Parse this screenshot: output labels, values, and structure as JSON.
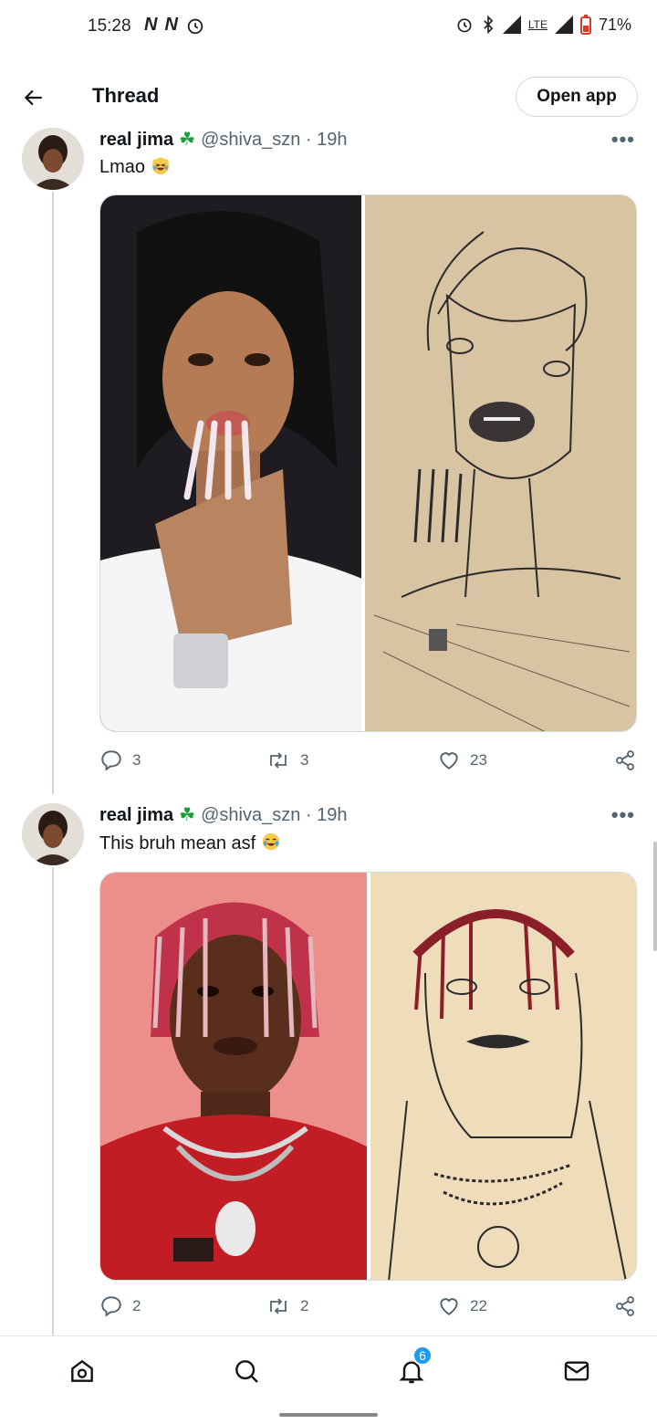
{
  "status_bar": {
    "time": "15:28",
    "network": "LTE",
    "battery": "71%"
  },
  "header": {
    "title": "Thread",
    "open_app_label": "Open app"
  },
  "tweets": [
    {
      "name": "real jima",
      "handle": "@shiva_szn",
      "time": "19h",
      "text": "Lmao",
      "emoji": "laughing-cat-emoji",
      "replies": "3",
      "retweets": "3",
      "likes": "23",
      "media": [
        "photo-cardi-b",
        "drawing-cardi-b"
      ]
    },
    {
      "name": "real jima",
      "handle": "@shiva_szn",
      "time": "19h",
      "text": "This bruh mean asf",
      "emoji": "tears-of-joy-emoji",
      "replies": "2",
      "retweets": "2",
      "likes": "22",
      "media": [
        "photo-lil-yachty",
        "drawing-lil-yachty"
      ]
    }
  ],
  "bottom_nav": {
    "notifications_count": "6"
  },
  "colors": {
    "accent": "#1d9bf0",
    "text": "#0f1419",
    "secondary": "#536471",
    "border": "#cfd9de"
  }
}
